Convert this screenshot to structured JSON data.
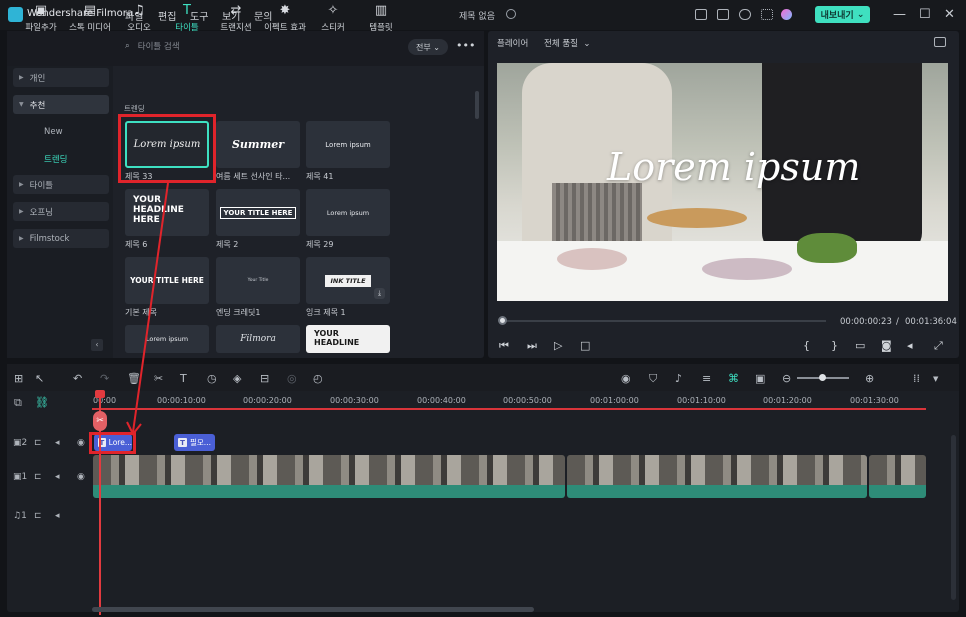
{
  "titlebar": {
    "app_name": "Wondershare Filmora",
    "menu": [
      "파일",
      "편집",
      "도구",
      "보기",
      "문의"
    ],
    "doc_title": "제목 없음",
    "export_label": "내보내기"
  },
  "toolbar": {
    "tabs": [
      {
        "label": "파일추가",
        "icon": "import-icon"
      },
      {
        "label": "스톡 미디어",
        "icon": "stock-media-icon"
      },
      {
        "label": "오디오",
        "icon": "music-note-icon"
      },
      {
        "label": "타이틀",
        "icon": "text-t-icon"
      },
      {
        "label": "트랜지션",
        "icon": "transition-icon"
      },
      {
        "label": "이펙트 효과",
        "icon": "sparkle-icon"
      },
      {
        "label": "스티커",
        "icon": "sticker-icon"
      },
      {
        "label": "템플릿",
        "icon": "template-icon"
      }
    ],
    "active_tab": "타이틀"
  },
  "sidebar": {
    "items": [
      {
        "label": "개인"
      },
      {
        "label": "추천"
      },
      {
        "label": "타이틀"
      },
      {
        "label": "오프닝"
      },
      {
        "label": "Filmstock"
      }
    ],
    "sub_items": [
      {
        "label": "New"
      },
      {
        "label": "트렌딩"
      }
    ]
  },
  "library": {
    "search_placeholder": "타이틀 검색",
    "filter_value": "전부",
    "section_label": "트렌딩",
    "items": [
      {
        "label": "제목 33",
        "preview": "Lorem ipsum"
      },
      {
        "label": "여름 세트 선사인 타...",
        "preview": "Summer"
      },
      {
        "label": "제목 41",
        "preview": "Lorem ipsum"
      },
      {
        "label": "제목 6",
        "preview": "YOUR HEADLINE HERE"
      },
      {
        "label": "제목 2",
        "preview": "YOUR TITLE HERE"
      },
      {
        "label": "제목 29",
        "preview": "Lorem ipsum"
      },
      {
        "label": "기본 제목",
        "preview": "YOUR TITLE HERE"
      },
      {
        "label": "엔딩 크레딧1",
        "preview": "Your Title"
      },
      {
        "label": "잉크 제목 1",
        "preview": "INK TITLE"
      },
      {
        "label": "",
        "preview": "Lorem ipsum"
      },
      {
        "label": "",
        "preview": "Filmora"
      },
      {
        "label": "",
        "preview": "YOUR HEADLINE"
      }
    ]
  },
  "preview": {
    "player_label": "플레이어",
    "quality_value": "전체 품질",
    "overlay_text": "Lorem ipsum",
    "current_time": "00:00:00:23",
    "separator": "/",
    "total_time": "00:01:36:04",
    "progress_fraction": 0.01
  },
  "timeline": {
    "ruler": [
      "00:00",
      "00:00:10:00",
      "00:00:20:00",
      "00:00:30:00",
      "00:00:40:00",
      "00:00:50:00",
      "00:01:00:00",
      "00:01:10:00",
      "00:01:20:00",
      "00:01:30:00"
    ],
    "tracks": [
      {
        "index": "2",
        "type": "title-track-icon"
      },
      {
        "index": "1",
        "type": "video-track-icon"
      },
      {
        "index": "1",
        "type": "audio-track-icon"
      }
    ],
    "title_clips": [
      {
        "label": "Lore..."
      },
      {
        "label": "필모..."
      }
    ]
  },
  "colors": {
    "accent": "#3ee0c2",
    "highlight": "#e0242b",
    "playhead": "#e23a3f",
    "video_clip": "#2e8c78",
    "title_clip": "#4a5fd6"
  }
}
